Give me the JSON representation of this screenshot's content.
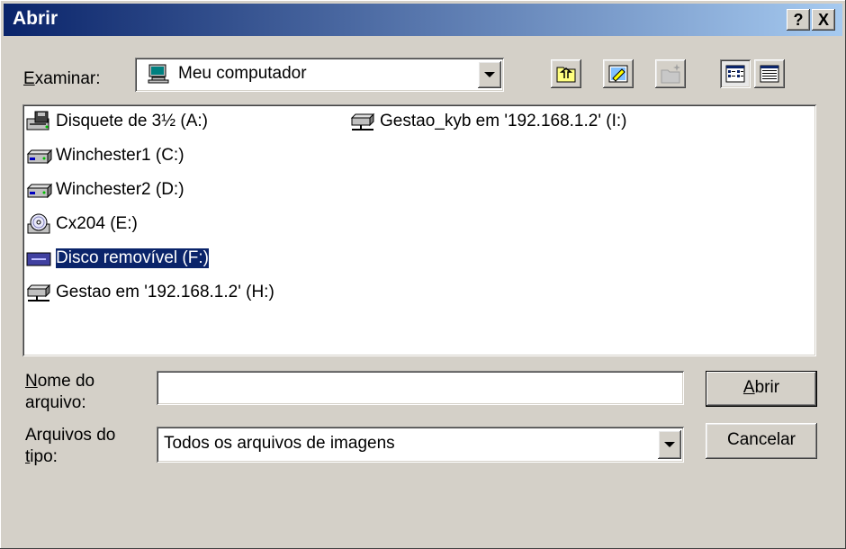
{
  "window": {
    "title": "Abrir",
    "help_button": "?",
    "close_button": "X"
  },
  "lookin": {
    "label_underline": "E",
    "label_rest": "xaminar:",
    "value": "Meu computador",
    "icon": "my-computer-icon"
  },
  "toolbar": {
    "up_icon": "up-folder-icon",
    "desktop_icon": "desktop-icon",
    "new_folder_icon": "new-folder-icon",
    "list_view_icon": "list-view-icon",
    "details_view_icon": "details-view-icon"
  },
  "files": [
    {
      "label": "Disquete de 3½ (A:)",
      "icon": "floppy-drive-icon",
      "selected": false
    },
    {
      "label": "Winchester1 (C:)",
      "icon": "hard-drive-icon",
      "selected": false
    },
    {
      "label": "Winchester2 (D:)",
      "icon": "hard-drive-icon",
      "selected": false
    },
    {
      "label": "Cx204 (E:)",
      "icon": "cd-drive-icon",
      "selected": false
    },
    {
      "label": "Disco removível (F:)",
      "icon": "removable-drive-icon",
      "selected": true
    },
    {
      "label": "Gestao em '192.168.1.2' (H:)",
      "icon": "network-drive-icon",
      "selected": false
    },
    {
      "label": "Gestao_kyb em '192.168.1.2' (I:)",
      "icon": "network-drive-icon",
      "selected": false
    }
  ],
  "filename": {
    "label_line1_underline": "N",
    "label_line1_rest": "ome do",
    "label_line2": "arquivo:",
    "value": ""
  },
  "filetype": {
    "label_line1": "Arquivos do",
    "label_line2_underline": "t",
    "label_line2_rest": "ipo:",
    "value": "Todos os arquivos de imagens"
  },
  "buttons": {
    "open_underline": "A",
    "open_rest": "brir",
    "cancel": "Cancelar"
  },
  "colors": {
    "title_gradient_start": "#0a246a",
    "title_gradient_end": "#a6caf0",
    "selection": "#0a246a",
    "face": "#d4d0c8"
  }
}
